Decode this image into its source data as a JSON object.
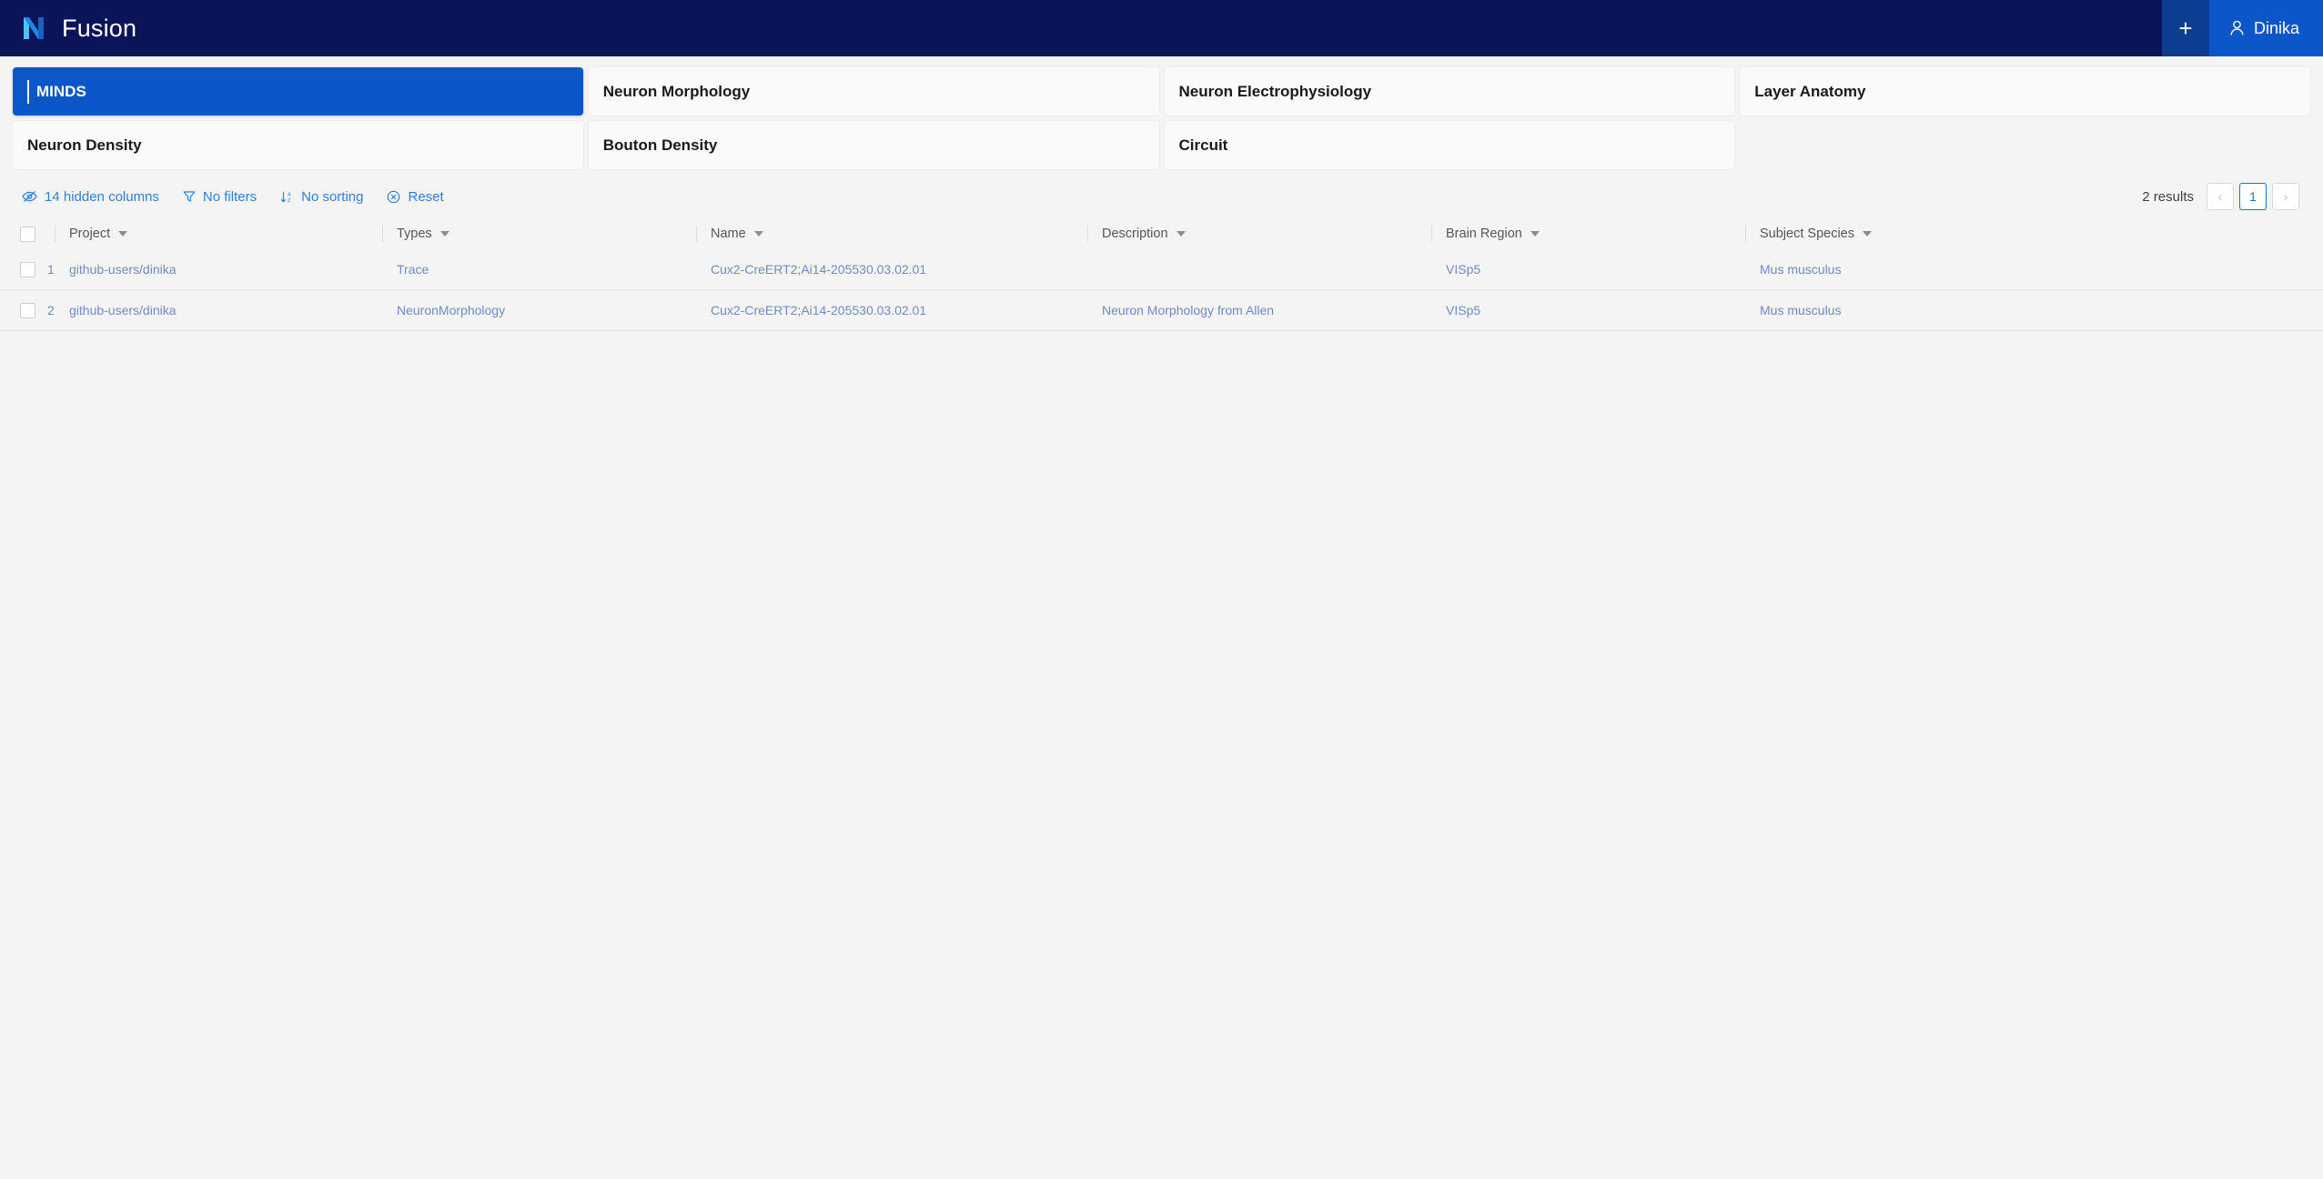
{
  "header": {
    "logo_name": "nexus-n-logo",
    "title": "Fusion",
    "add_label": "+",
    "user_name": "Dinika"
  },
  "cards": [
    {
      "label": "MINDS",
      "active": true
    },
    {
      "label": "Neuron Morphology",
      "active": false
    },
    {
      "label": "Neuron Electrophysiology",
      "active": false
    },
    {
      "label": "Layer Anatomy",
      "active": false
    },
    {
      "label": "Neuron Density",
      "active": false
    },
    {
      "label": "Bouton Density",
      "active": false
    },
    {
      "label": "Circuit",
      "active": false
    },
    {
      "label": "",
      "active": false,
      "empty": true
    }
  ],
  "toolbar": {
    "hidden_columns": "14 hidden columns",
    "filters": "No filters",
    "sorting": "No sorting",
    "reset": "Reset"
  },
  "pagination": {
    "results": "2 results",
    "prev": "‹",
    "page": "1",
    "next": "›"
  },
  "table": {
    "columns": [
      {
        "label": "Project"
      },
      {
        "label": "Types"
      },
      {
        "label": "Name"
      },
      {
        "label": "Description"
      },
      {
        "label": "Brain Region"
      },
      {
        "label": "Subject Species"
      }
    ],
    "rows": [
      {
        "index": "1",
        "project": "github-users/dinika",
        "types": "Trace",
        "name": "Cux2-CreERT2;Ai14-205530.03.02.01",
        "description": "",
        "brain_region": "VISp5",
        "subject_species": "Mus musculus"
      },
      {
        "index": "2",
        "project": "github-users/dinika",
        "types": "NeuronMorphology",
        "name": "Cux2-CreERT2;Ai14-205530.03.02.01",
        "description": "Neuron Morphology from Allen",
        "brain_region": "VISp5",
        "subject_species": "Mus musculus"
      }
    ]
  },
  "colors": {
    "header_bg": "#0b1359",
    "accent_blue": "#0b57c9",
    "link_blue": "#2f80d8",
    "page_bg": "#f4f4f4"
  }
}
